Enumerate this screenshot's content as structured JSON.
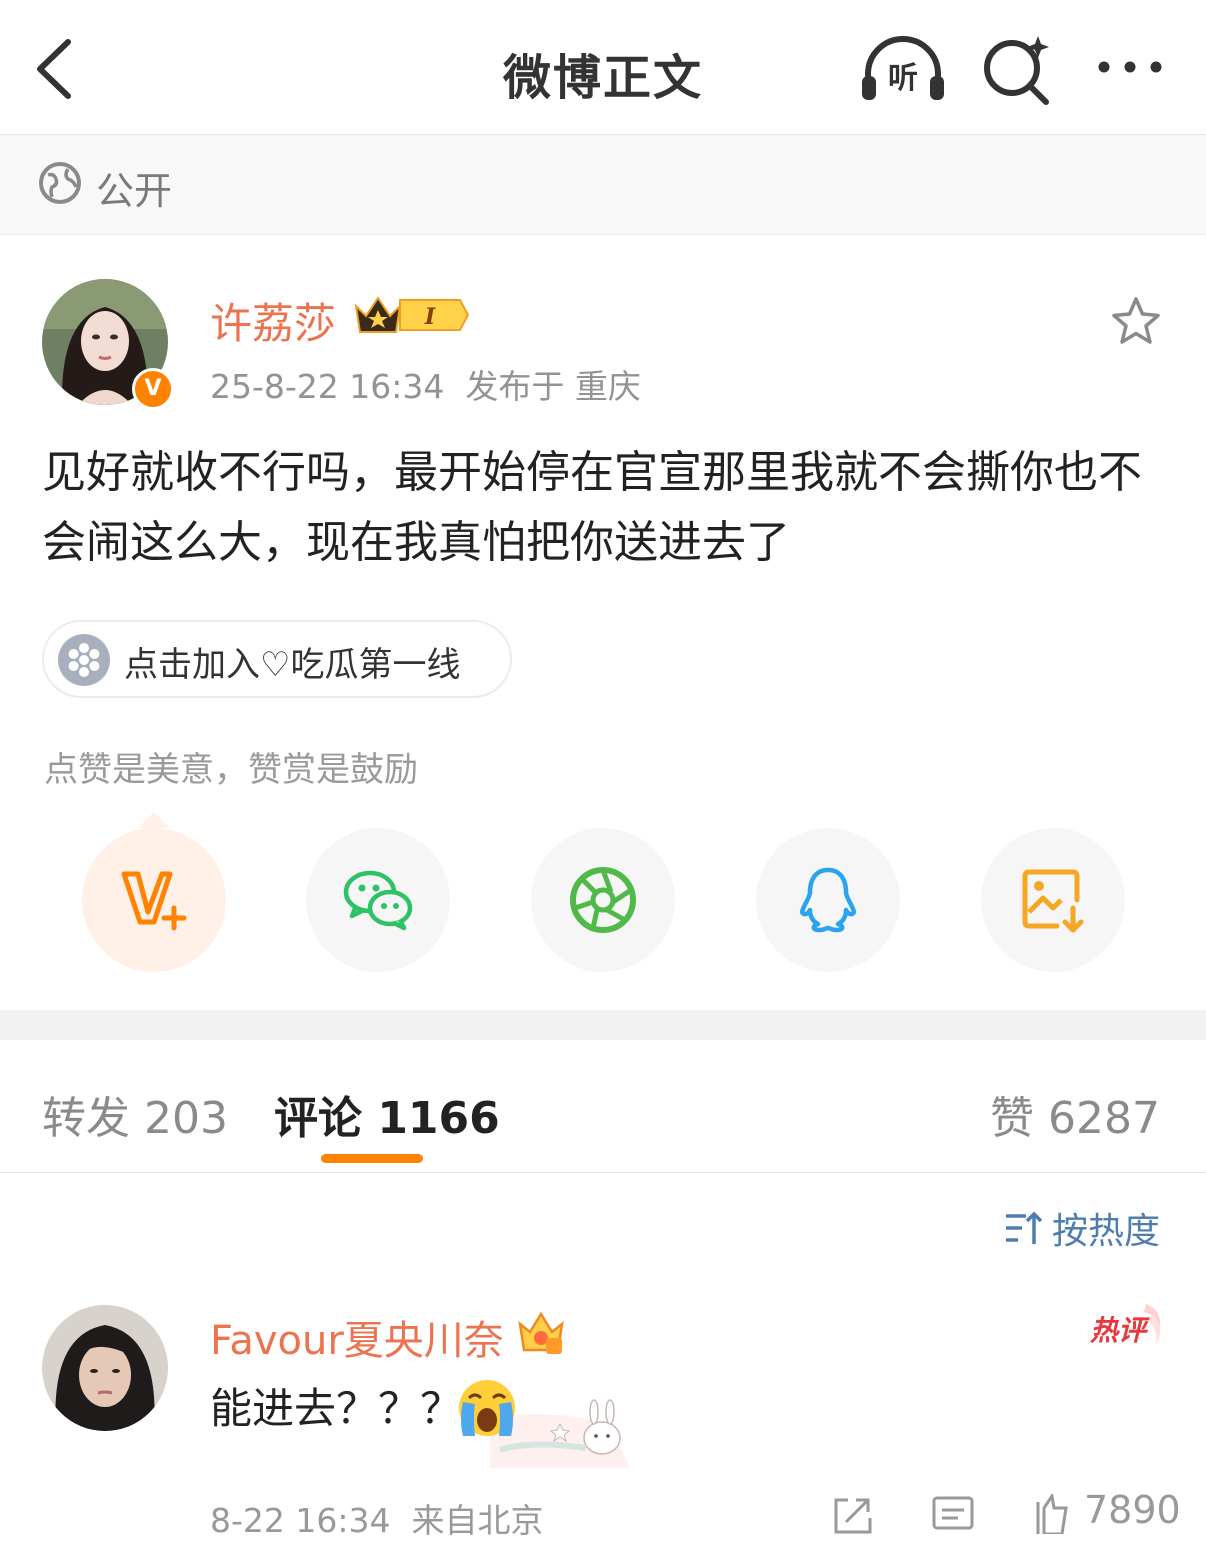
{
  "header": {
    "title": "微博正文",
    "listen_label": "听"
  },
  "visibility": {
    "label": "公开"
  },
  "post": {
    "author": "许荔莎",
    "vip_level": "I",
    "verified_mark": "V",
    "meta": "25-8-22 16:34  发布于 重庆",
    "text": "见好就收不行吗，最开始停在官宣那里我就不会撕你也不会闹这么大，现在我真怕把你送进去了",
    "topic": "点击加入♡吃瓜第一线",
    "reward_text": "点赞是美意，赞赏是鼓励"
  },
  "share_targets": [
    {
      "name": "vplus",
      "icon": "v-plus-icon",
      "color": "#ff8200"
    },
    {
      "name": "wechat",
      "icon": "wechat-icon",
      "color": "#2ec165"
    },
    {
      "name": "moments",
      "icon": "moments-icon",
      "color": "#50b94a"
    },
    {
      "name": "qq",
      "icon": "qq-icon",
      "color": "#2aa4ee"
    },
    {
      "name": "save",
      "icon": "save-image-icon",
      "color": "#f5a623"
    }
  ],
  "tabs": {
    "repost": "转发 203",
    "comment": "评论 1166",
    "like": "赞 6287"
  },
  "sort": {
    "label": "按热度"
  },
  "comment": {
    "user": "Favour夏央川奈",
    "hot_label": "热评",
    "text": "能进去？？？",
    "meta": "8-22 16:34  来自北京",
    "likes": "7890"
  },
  "colors": {
    "accent": "#ff8200",
    "name": "#eb7350",
    "link": "#507daf"
  }
}
